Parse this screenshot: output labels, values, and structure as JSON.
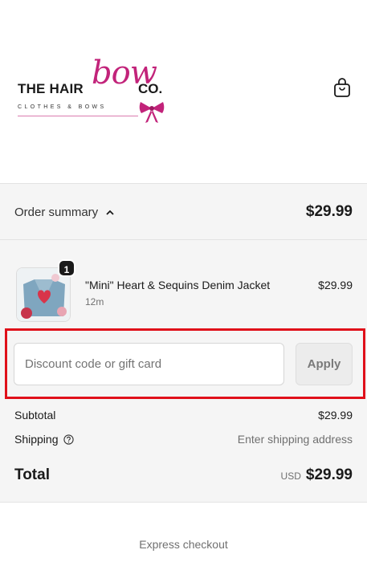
{
  "brand": {
    "name_part1": "THE HAIR",
    "name_script": "bow",
    "name_part2": "CO.",
    "tagline": "CLOTHES & BOWS"
  },
  "header": {
    "cart_icon": "shopping-bag-icon"
  },
  "order_summary": {
    "toggle_label": "Order summary",
    "toggle_icon": "chevron-up-icon",
    "total": "$29.99"
  },
  "line_item": {
    "quantity": "1",
    "name": "\"Mini\" Heart & Sequins Denim Jacket",
    "variant": "12m",
    "price": "$29.99"
  },
  "discount": {
    "placeholder": "Discount code or gift card",
    "value": "",
    "apply_label": "Apply"
  },
  "totals": {
    "subtotal_label": "Subtotal",
    "subtotal_value": "$29.99",
    "shipping_label": "Shipping",
    "shipping_value": "Enter shipping address",
    "total_label": "Total",
    "currency": "USD",
    "total_value": "$29.99"
  },
  "express_checkout_label": "Express checkout",
  "colors": {
    "brand_pink": "#c2237a",
    "highlight": "#e0101a",
    "panel_bg": "#f5f5f5"
  }
}
